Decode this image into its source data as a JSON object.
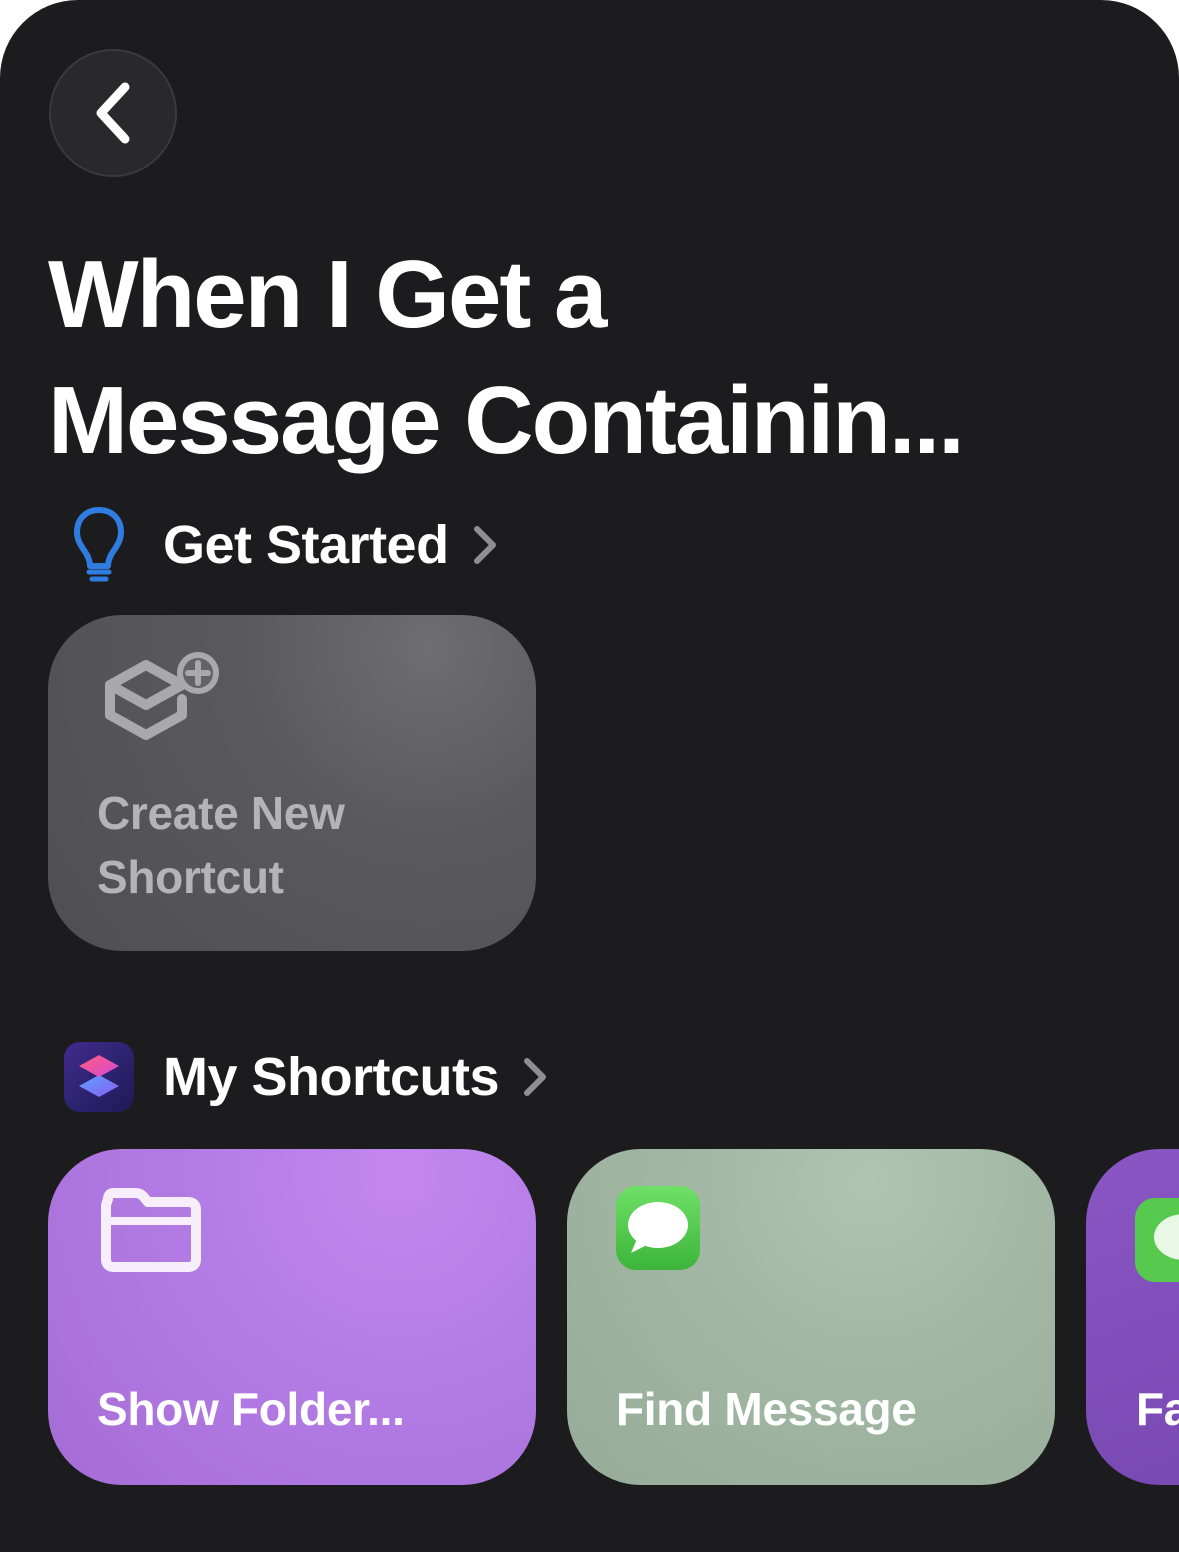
{
  "title": "When I Get a\nMessage Containin...",
  "sections": {
    "get_started": {
      "label": "Get Started",
      "icon": "lightbulb-icon",
      "icon_color": "#2f7de0"
    },
    "my_shortcuts": {
      "label": "My Shortcuts",
      "icon": "shortcuts-app-icon"
    }
  },
  "create_card": {
    "label": "Create New\nShortcut",
    "icon": "add-shortcut-icon"
  },
  "shortcuts": [
    {
      "label": "Show Folder...",
      "icon": "folder-icon",
      "color": "#b47de6"
    },
    {
      "label": "Find Message",
      "icon": "messages-icon",
      "color": "#a2b8a4"
    },
    {
      "label": "Fa",
      "icon": "messages-icon",
      "color": "#7a4ab5"
    }
  ],
  "colors": {
    "background": "#1c1c1e",
    "text": "#ffffff",
    "chevron": "#8e8e93"
  }
}
